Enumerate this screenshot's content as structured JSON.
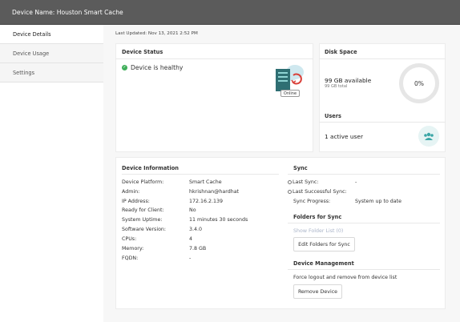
{
  "header": {
    "title": "Device Name: Houston Smart Cache"
  },
  "sidebar": {
    "items": [
      {
        "label": "Device Details"
      },
      {
        "label": "Device Usage"
      },
      {
        "label": "Settings"
      }
    ]
  },
  "last_updated": "Last Updated: Nov 13, 2021 2:52 PM",
  "device_status": {
    "title": "Device Status",
    "status": "Device is healthy",
    "badge": "Online"
  },
  "disk_space": {
    "title": "Disk Space",
    "available": "99 GB available",
    "total": "99 GB total",
    "percent": "0%"
  },
  "users": {
    "title": "Users",
    "count": "1 active user"
  },
  "device_info": {
    "title": "Device Information",
    "rows": [
      {
        "label": "Device Platform:",
        "value": "Smart Cache"
      },
      {
        "label": "Admin:",
        "value": "hkrishnan@hardhat"
      },
      {
        "label": "IP Address:",
        "value": "172.16.2.139"
      },
      {
        "label": "Ready for Client:",
        "value": "No"
      },
      {
        "label": "System Uptime:",
        "value": "11 minutes 30 seconds"
      },
      {
        "label": "Software Version:",
        "value": "3.4.0"
      },
      {
        "label": "CPUs:",
        "value": "4"
      },
      {
        "label": "Memory:",
        "value": "7.8 GB"
      },
      {
        "label": "FQDN:",
        "value": "-"
      }
    ]
  },
  "sync": {
    "title": "Sync",
    "last_sync_label": "Last Sync:",
    "last_sync_value": "-",
    "last_successful_label": "Last Successful Sync:",
    "progress_label": "Sync Progress:",
    "progress_value": "System up to date",
    "folders_title": "Folders for Sync",
    "show_folder_list": "Show Folder List (0)",
    "edit_folders_button": "Edit Folders for Sync"
  },
  "device_management": {
    "title": "Device Management",
    "description": "Force logout and remove from device list",
    "remove_button": "Remove Device"
  },
  "colors": {
    "header_bg": "#5b5b5b",
    "healthy_green": "#3fae5a",
    "accent_teal": "#3aa6a6",
    "cloud_blue": "#cfe8ef",
    "red_sync": "#d9413a"
  }
}
